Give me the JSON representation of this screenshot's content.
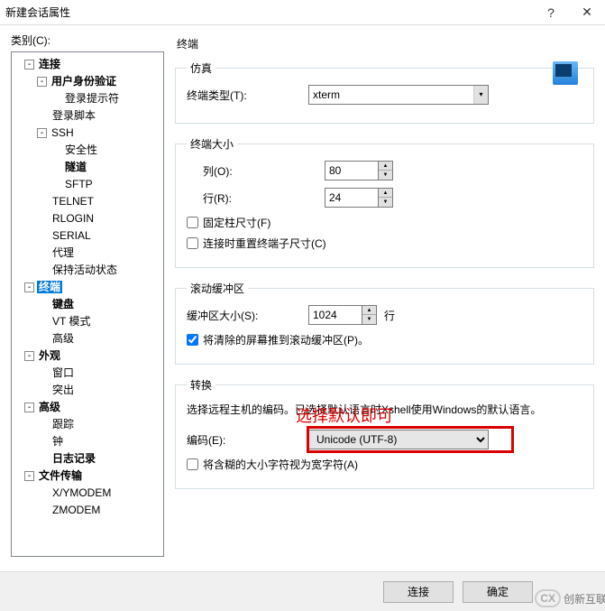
{
  "title": "新建会话属性",
  "category_label": "类别(C):",
  "tree": {
    "connection": "连接",
    "auth": "用户身份验证",
    "login_prompt": "登录提示符",
    "login_script": "登录脚本",
    "ssh": "SSH",
    "security": "安全性",
    "tunnel": "隧道",
    "sftp": "SFTP",
    "telnet": "TELNET",
    "rlogin": "RLOGIN",
    "serial": "SERIAL",
    "proxy": "代理",
    "keepalive": "保持活动状态",
    "terminal": "终端",
    "keyboard": "键盘",
    "vt": "VT 模式",
    "advanced": "高级",
    "appearance": "外观",
    "window": "窗口",
    "highlight": "突出",
    "advanced2": "高级",
    "trace": "跟踪",
    "bell": "钟",
    "logging": "日志记录",
    "filetransfer": "文件传输",
    "xymodem": "X/YMODEM",
    "zmodem": "ZMODEM"
  },
  "panel": {
    "header": "终端",
    "emulation": {
      "legend": "仿真",
      "type_label": "终端类型(T):",
      "type_value": "xterm"
    },
    "size": {
      "legend": "终端大小",
      "cols_label": "列(O):",
      "cols_value": "80",
      "rows_label": "行(R):",
      "rows_value": "24",
      "fixcol_label": "固定柱尺寸(F)",
      "reset_label": "连接时重置终端子尺寸(C)"
    },
    "scroll": {
      "legend": "滚动缓冲区",
      "size_label": "缓冲区大小(S):",
      "size_value": "1024",
      "unit": "行",
      "push_label": "将清除的屏幕推到滚动缓冲区(P)。",
      "push_checked": true
    },
    "convert": {
      "legend": "转换",
      "desc": "选择远程主机的编码。已选择默认语言时Xshell使用Windows的默认语言。",
      "enc_label": "编码(E):",
      "enc_value": "Unicode (UTF-8)",
      "wide_label": "将含糊的大小字符视为宽字符(A)"
    }
  },
  "annotation": "选择默认即可",
  "buttons": {
    "connect": "连接",
    "ok": "确定"
  },
  "brand": "创新互联"
}
